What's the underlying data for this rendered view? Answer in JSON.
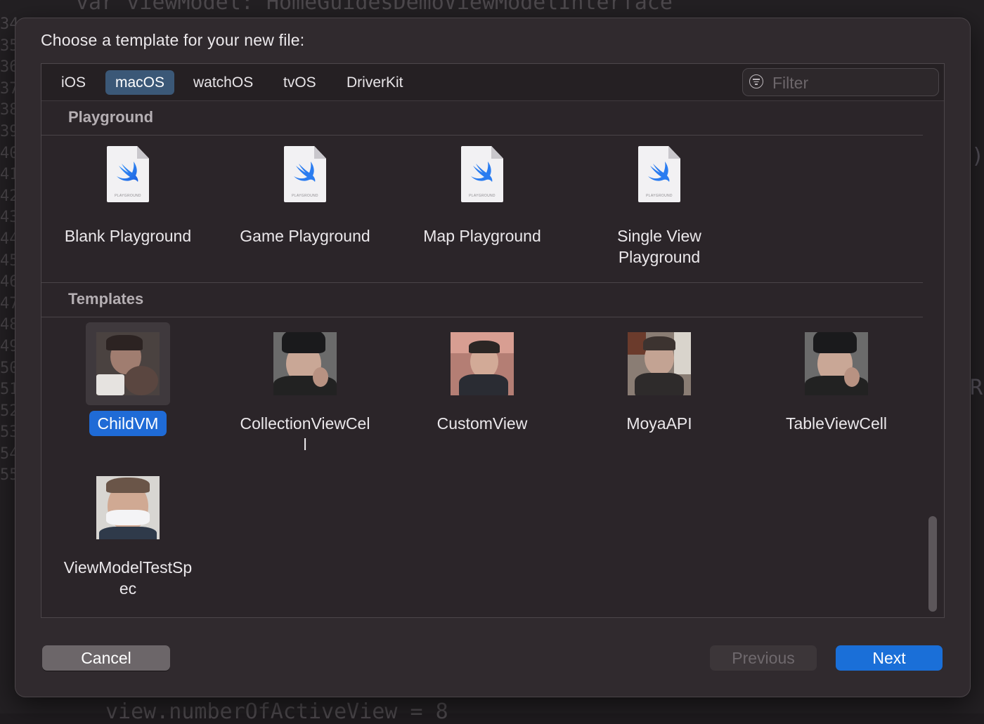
{
  "dialog": {
    "title": "Choose a template for your new file:"
  },
  "platform_tabs": [
    {
      "label": "iOS",
      "selected": false
    },
    {
      "label": "macOS",
      "selected": true
    },
    {
      "label": "watchOS",
      "selected": false
    },
    {
      "label": "tvOS",
      "selected": false
    },
    {
      "label": "DriverKit",
      "selected": false
    }
  ],
  "filter": {
    "placeholder": "Filter",
    "value": ""
  },
  "sections": [
    {
      "title": "Playground",
      "items": [
        {
          "label": "Blank Playground",
          "icon": "swift-playground-file-icon",
          "icon_caption": "PLAYGROUND"
        },
        {
          "label": "Game Playground",
          "icon": "swift-playground-file-icon",
          "icon_caption": "PLAYGROUND"
        },
        {
          "label": "Map Playground",
          "icon": "swift-playground-file-icon",
          "icon_caption": "PLAYGROUND"
        },
        {
          "label": "Single View Playground",
          "icon": "swift-playground-file-icon",
          "icon_caption": "PLAYGROUND"
        }
      ]
    },
    {
      "title": "Templates",
      "items": [
        {
          "label": "ChildVM",
          "icon": "photo-thumbnail",
          "selected": true
        },
        {
          "label": "CollectionViewCell",
          "icon": "photo-thumbnail",
          "selected": false
        },
        {
          "label": "CustomView",
          "icon": "photo-thumbnail",
          "selected": false
        },
        {
          "label": "MoyaAPI",
          "icon": "photo-thumbnail",
          "selected": false
        },
        {
          "label": "TableViewCell",
          "icon": "photo-thumbnail",
          "selected": false
        },
        {
          "label": "ViewModelTestSpec",
          "icon": "photo-thumbnail",
          "selected": false
        }
      ]
    }
  ],
  "buttons": {
    "cancel": "Cancel",
    "previous": "Previous",
    "next": "Next",
    "previous_enabled": false
  },
  "colors": {
    "accent": "#1a6fd8",
    "selected_tab": "#3b5877",
    "sheet_background": "#302a2e"
  },
  "background_editor": {
    "line_numbers": [
      "34",
      "35",
      "36",
      "37",
      "38",
      "39",
      "40",
      "41",
      "42",
      "43",
      "44",
      "45",
      "46",
      "47",
      "48",
      "49",
      "50",
      "51",
      "52",
      "53",
      "54",
      "55"
    ],
    "top_code": "var viewModel: HomeGuidesDemoViewModelInterface",
    "bottom_code": "view.numberOfActiveView = 8",
    "right_fragment_1": ")",
    "right_fragment_2": "R"
  }
}
